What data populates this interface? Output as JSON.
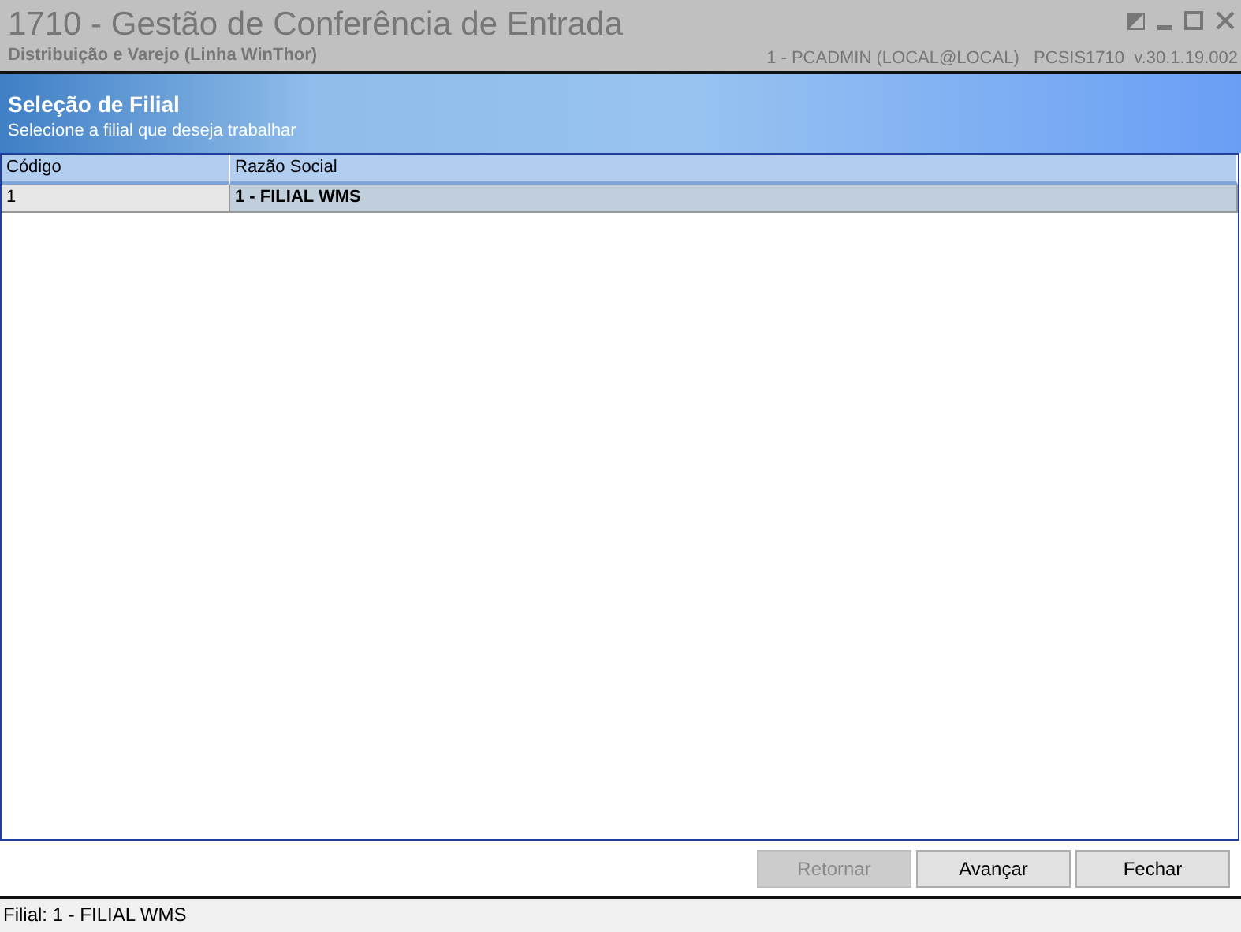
{
  "window": {
    "title": "1710 - Gestão de Conferência de Entrada",
    "subtitle": "Distribuição e Varejo (Linha WinThor)",
    "session_info": "1 - PCADMIN (LOCAL@LOCAL)   PCSIS1710  v.30.1.19.002"
  },
  "header": {
    "title": "Seleção de Filial",
    "description": "Selecione a filial que deseja trabalhar"
  },
  "table": {
    "columns": [
      "Código",
      "Razão Social"
    ],
    "rows": [
      {
        "cells": [
          "1",
          "1 - FILIAL WMS"
        ],
        "selected": true
      }
    ]
  },
  "buttons": [
    {
      "label": "Retornar",
      "disabled": true
    },
    {
      "label": "Avançar",
      "disabled": false
    },
    {
      "label": "Fechar",
      "disabled": false
    }
  ],
  "status_bar": "Filial: 1 - FILIAL WMS"
}
